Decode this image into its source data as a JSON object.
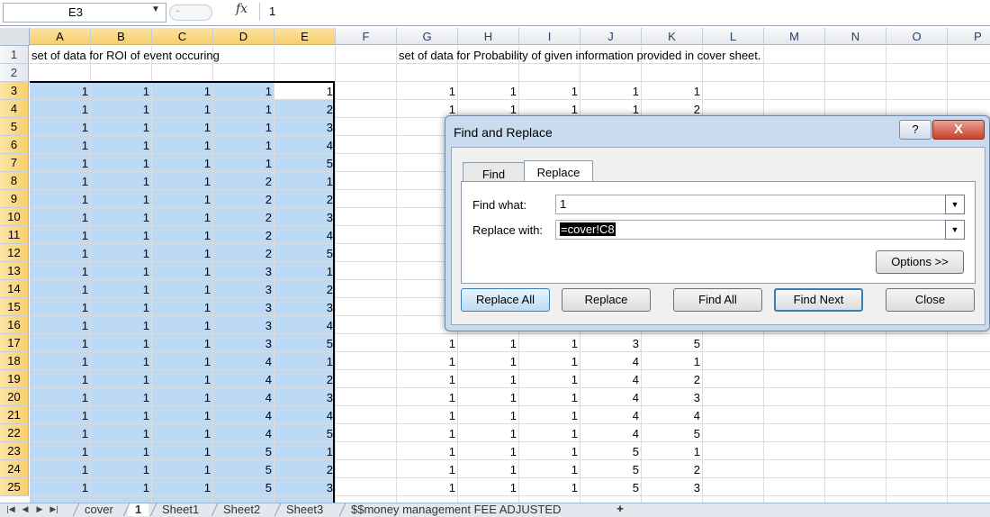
{
  "name_box": "E3",
  "formula": "1",
  "fx_label": "fx",
  "columns": [
    "A",
    "B",
    "C",
    "D",
    "E",
    "F",
    "G",
    "H",
    "I",
    "J",
    "K",
    "L",
    "M",
    "N",
    "O",
    "P"
  ],
  "rows": [
    "1",
    "2",
    "3",
    "4",
    "5",
    "6",
    "7",
    "8",
    "9",
    "10",
    "11",
    "12",
    "13",
    "14",
    "15",
    "16",
    "17",
    "18",
    "19",
    "20",
    "21",
    "22",
    "23",
    "24",
    "25"
  ],
  "row1": {
    "A": "set of data for ROI of event occuring",
    "G": "set of data for Probability of given information provided in cover sheet."
  },
  "left_data": [
    [
      "1",
      "1",
      "1",
      "1",
      "1"
    ],
    [
      "1",
      "1",
      "1",
      "1",
      "2"
    ],
    [
      "1",
      "1",
      "1",
      "1",
      "3"
    ],
    [
      "1",
      "1",
      "1",
      "1",
      "4"
    ],
    [
      "1",
      "1",
      "1",
      "1",
      "5"
    ],
    [
      "1",
      "1",
      "1",
      "2",
      "1"
    ],
    [
      "1",
      "1",
      "1",
      "2",
      "2"
    ],
    [
      "1",
      "1",
      "1",
      "2",
      "3"
    ],
    [
      "1",
      "1",
      "1",
      "2",
      "4"
    ],
    [
      "1",
      "1",
      "1",
      "2",
      "5"
    ],
    [
      "1",
      "1",
      "1",
      "3",
      "1"
    ],
    [
      "1",
      "1",
      "1",
      "3",
      "2"
    ],
    [
      "1",
      "1",
      "1",
      "3",
      "3"
    ],
    [
      "1",
      "1",
      "1",
      "3",
      "4"
    ],
    [
      "1",
      "1",
      "1",
      "3",
      "5"
    ],
    [
      "1",
      "1",
      "1",
      "4",
      "1"
    ],
    [
      "1",
      "1",
      "1",
      "4",
      "2"
    ],
    [
      "1",
      "1",
      "1",
      "4",
      "3"
    ],
    [
      "1",
      "1",
      "1",
      "4",
      "4"
    ],
    [
      "1",
      "1",
      "1",
      "4",
      "5"
    ],
    [
      "1",
      "1",
      "1",
      "5",
      "1"
    ],
    [
      "1",
      "1",
      "1",
      "5",
      "2"
    ],
    [
      "1",
      "1",
      "1",
      "5",
      "3"
    ]
  ],
  "right_data": [
    [
      "1",
      "1",
      "1",
      "1",
      "1"
    ],
    [
      "1",
      "1",
      "1",
      "1",
      "2"
    ],
    [
      "",
      "",
      "",
      "",
      ""
    ],
    [
      "",
      "",
      "",
      "",
      ""
    ],
    [
      "",
      "",
      "",
      "",
      ""
    ],
    [
      "",
      "",
      "",
      "",
      ""
    ],
    [
      "",
      "",
      "",
      "",
      ""
    ],
    [
      "",
      "",
      "",
      "",
      ""
    ],
    [
      "",
      "",
      "",
      "",
      ""
    ],
    [
      "",
      "",
      "",
      "",
      ""
    ],
    [
      "",
      "",
      "",
      "",
      ""
    ],
    [
      "",
      "",
      "",
      "",
      ""
    ],
    [
      "",
      "",
      "",
      "",
      ""
    ],
    [
      "",
      "",
      "",
      "",
      ""
    ],
    [
      "1",
      "1",
      "1",
      "3",
      "5"
    ],
    [
      "1",
      "1",
      "1",
      "4",
      "1"
    ],
    [
      "1",
      "1",
      "1",
      "4",
      "2"
    ],
    [
      "1",
      "1",
      "1",
      "4",
      "3"
    ],
    [
      "1",
      "1",
      "1",
      "4",
      "4"
    ],
    [
      "1",
      "1",
      "1",
      "4",
      "5"
    ],
    [
      "1",
      "1",
      "1",
      "5",
      "1"
    ],
    [
      "1",
      "1",
      "1",
      "5",
      "2"
    ],
    [
      "1",
      "1",
      "1",
      "5",
      "3"
    ]
  ],
  "sheet_tabs": [
    "cover",
    "1",
    "Sheet1",
    "Sheet2",
    "Sheet3",
    "$$money management FEE ADJUSTED"
  ],
  "active_tab": "1",
  "dialog": {
    "title": "Find and Replace",
    "help": "?",
    "close": "X",
    "tab_find": "Find",
    "tab_replace": "Replace",
    "find_label": "Find what:",
    "find_value": "1",
    "replace_label": "Replace with:",
    "replace_value": "=cover!C8",
    "options": "Options >>",
    "replace_all": "Replace All",
    "replace": "Replace",
    "find_all": "Find All",
    "find_next": "Find Next",
    "close_btn": "Close"
  }
}
